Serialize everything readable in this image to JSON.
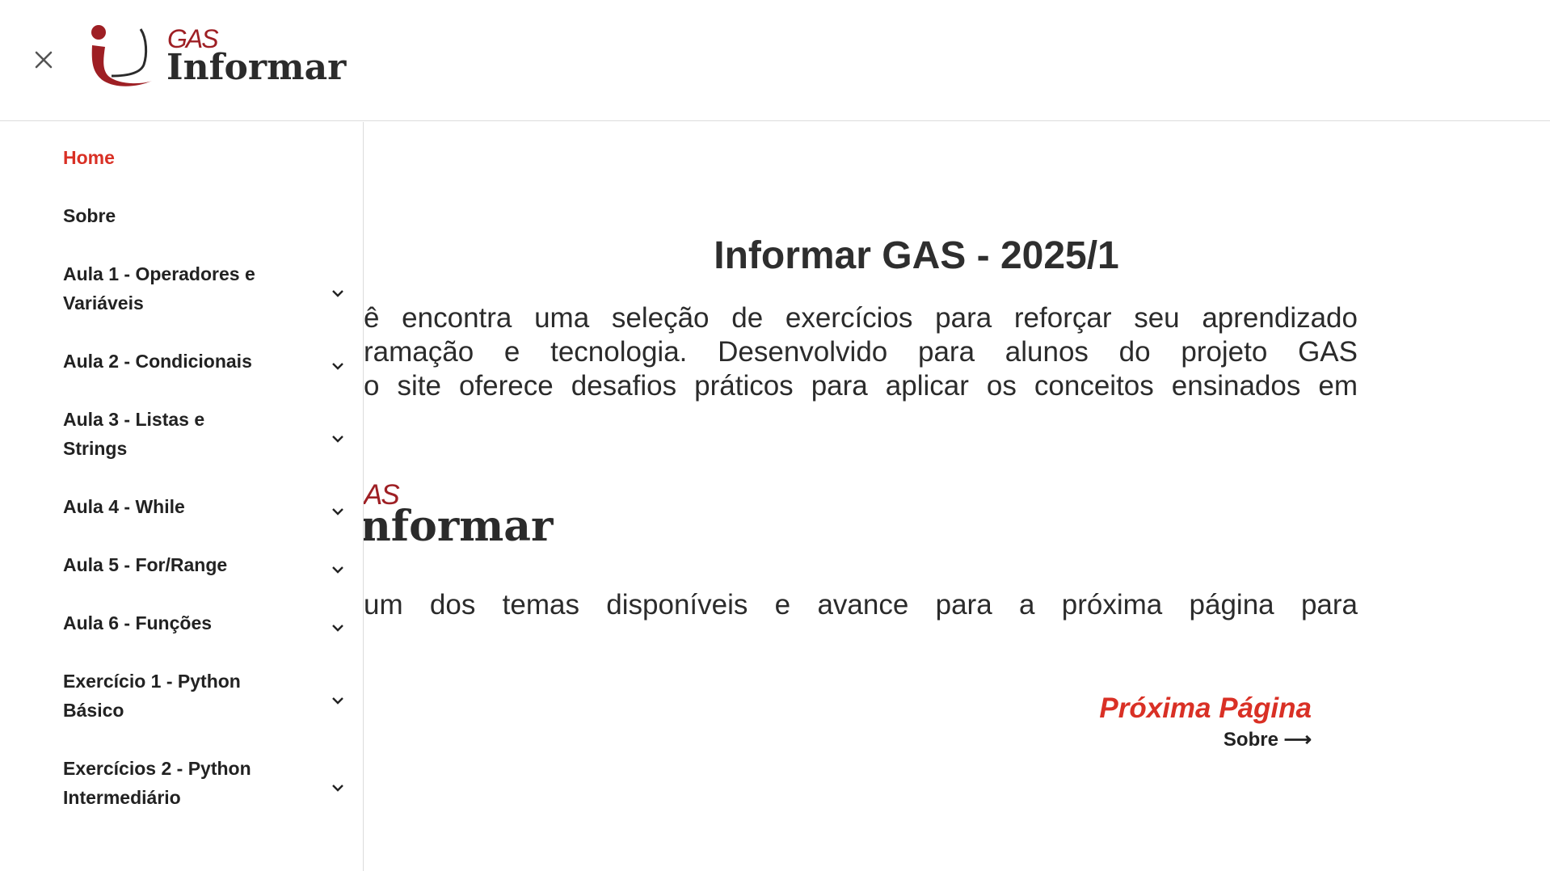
{
  "header": {
    "logo_gas": "GAS",
    "logo_informar": "Informar",
    "close_icon": "close-icon"
  },
  "sidebar": {
    "items": [
      {
        "label": "Home",
        "active": true,
        "expandable": false
      },
      {
        "label": "Sobre",
        "active": false,
        "expandable": false
      },
      {
        "label": "Aula 1 - Operadores e Variáveis",
        "active": false,
        "expandable": true
      },
      {
        "label": "Aula 2 - Condicionais",
        "active": false,
        "expandable": true
      },
      {
        "label": "Aula 3 - Listas e Strings",
        "active": false,
        "expandable": true
      },
      {
        "label": "Aula 4 - While",
        "active": false,
        "expandable": true
      },
      {
        "label": "Aula 5 - For/Range",
        "active": false,
        "expandable": true
      },
      {
        "label": "Aula 6 - Funções",
        "active": false,
        "expandable": true
      },
      {
        "label": "Exercício 1 - Python Básico",
        "active": false,
        "expandable": true
      },
      {
        "label": "Exercícios 2 - Python Intermediário",
        "active": false,
        "expandable": true
      }
    ]
  },
  "main": {
    "title": "Informar GAS - 2025/1",
    "intro_line1": "ê encontra uma seleção de exercícios para reforçar seu aprendizado",
    "intro_line2": "ramação e tecnologia. Desenvolvido para alunos do projeto GAS",
    "intro_line3": "o site oferece desafios práticos para aplicar os conceitos ensinados em",
    "logo_gas": "AS",
    "logo_informar": "nformar",
    "choose_text": "um dos temas disponíveis e avance para a próxima página para",
    "next_title": "Próxima Página",
    "next_sub": "Sobre ⟶"
  },
  "colors": {
    "accent": "#d93025",
    "logo_red": "#9e1f24",
    "text": "#222222"
  }
}
